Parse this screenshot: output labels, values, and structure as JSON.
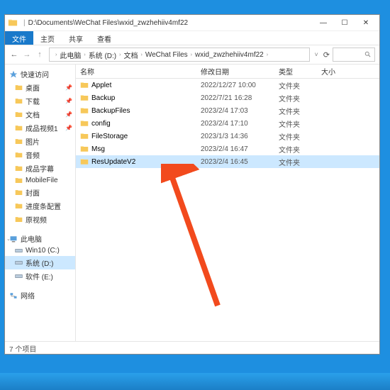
{
  "window": {
    "title_path": "D:\\Documents\\WeChat Files\\wxid_zwzhehiiv4mf22",
    "min": "—",
    "max": "☐",
    "close": "✕"
  },
  "ribbon": {
    "file": "文件",
    "home": "主页",
    "share": "共享",
    "view": "查看"
  },
  "breadcrumb": {
    "pc": "此电脑",
    "drive": "系统 (D:)",
    "docs": "文档",
    "wechat": "WeChat Files",
    "wxid": "wxid_zwzhehiiv4mf22"
  },
  "search": {
    "placeholder": ""
  },
  "sidebar": {
    "quick": "快速访问",
    "items_quick": [
      {
        "label": "桌面"
      },
      {
        "label": "下载"
      },
      {
        "label": "文档"
      },
      {
        "label": "成品视频1"
      },
      {
        "label": "图片"
      },
      {
        "label": "音频"
      },
      {
        "label": "成品字幕"
      },
      {
        "label": "MobileFile"
      },
      {
        "label": "封面"
      },
      {
        "label": "进度条配置"
      },
      {
        "label": "原视频"
      }
    ],
    "pc": "此电脑",
    "drives": [
      {
        "label": "Win10 (C:)"
      },
      {
        "label": "系统 (D:)"
      },
      {
        "label": "软件 (E:)"
      }
    ],
    "network": "网络"
  },
  "columns": {
    "name": "名称",
    "date": "修改日期",
    "type": "类型",
    "size": "大小"
  },
  "rows": [
    {
      "name": "Applet",
      "date": "2022/12/27 10:00",
      "type": "文件夹"
    },
    {
      "name": "Backup",
      "date": "2022/7/21 16:28",
      "type": "文件夹"
    },
    {
      "name": "BackupFiles",
      "date": "2023/2/4 17:03",
      "type": "文件夹"
    },
    {
      "name": "config",
      "date": "2023/2/4 17:10",
      "type": "文件夹"
    },
    {
      "name": "FileStorage",
      "date": "2023/1/3 14:36",
      "type": "文件夹"
    },
    {
      "name": "Msg",
      "date": "2023/2/4 16:47",
      "type": "文件夹"
    },
    {
      "name": "ResUpdateV2",
      "date": "2023/2/4 16:45",
      "type": "文件夹",
      "selected": true
    }
  ],
  "status": "7 个项目",
  "accent": "#1979ca",
  "folder_color": "#f7c85a"
}
